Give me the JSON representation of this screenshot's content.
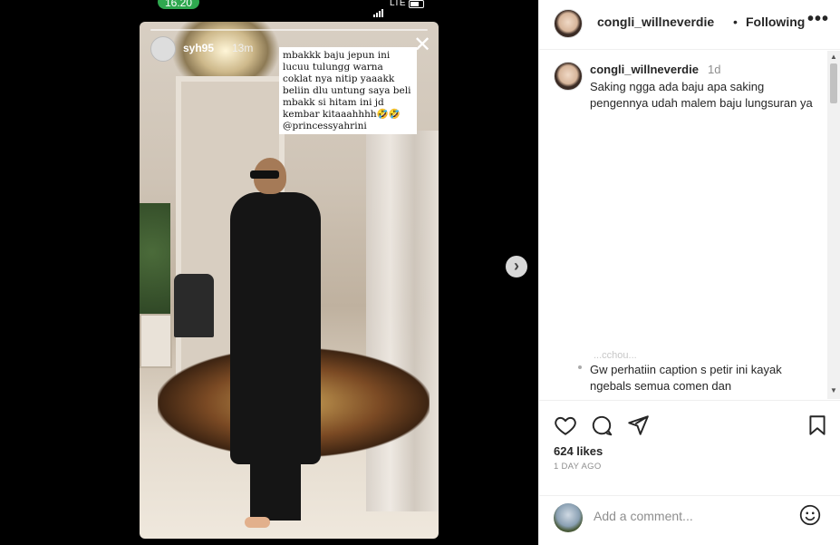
{
  "status_bar": {
    "time": "16.20",
    "network": "LTE"
  },
  "story": {
    "username": "syh95",
    "age": "13m",
    "caption_text": "mbakkk baju jepun ini lucuu tulungg warna coklat nya nitip yaaakk beliin dlu untung saya beli mbakk si hitam ini jd kembar kitaaahhhh🤣🤣 @princessyahrini",
    "close_icon": "close-icon",
    "next_icon": "chevron-right-icon",
    "page_count": 5,
    "current_page": 1
  },
  "post_header": {
    "username": "congli_willneverdie",
    "separator": "•",
    "follow_label": "Following",
    "more_icon": "more-icon"
  },
  "caption": {
    "username": "congli_willneverdie",
    "age": "1d",
    "text": "Saking ngga ada baju apa saking pengennya udah malem baju lungsuran ya"
  },
  "comment_preview": {
    "faded_user": "...cchou...",
    "text": "Gw perhatiin caption s petir ini kayak ngebals semua comen dan"
  },
  "actions": {
    "like_icon": "heart-icon",
    "comment_icon": "comment-icon",
    "share_icon": "send-icon",
    "save_icon": "bookmark-icon"
  },
  "likes": "624 likes",
  "date": "1 DAY AGO",
  "add_comment": {
    "placeholder": "Add a comment...",
    "emoji_icon": "emoji-icon"
  },
  "colors": {
    "text_primary": "#262626",
    "text_secondary": "#8e8e8e",
    "divider": "#efefef",
    "status_pill": "#2fa84f"
  }
}
